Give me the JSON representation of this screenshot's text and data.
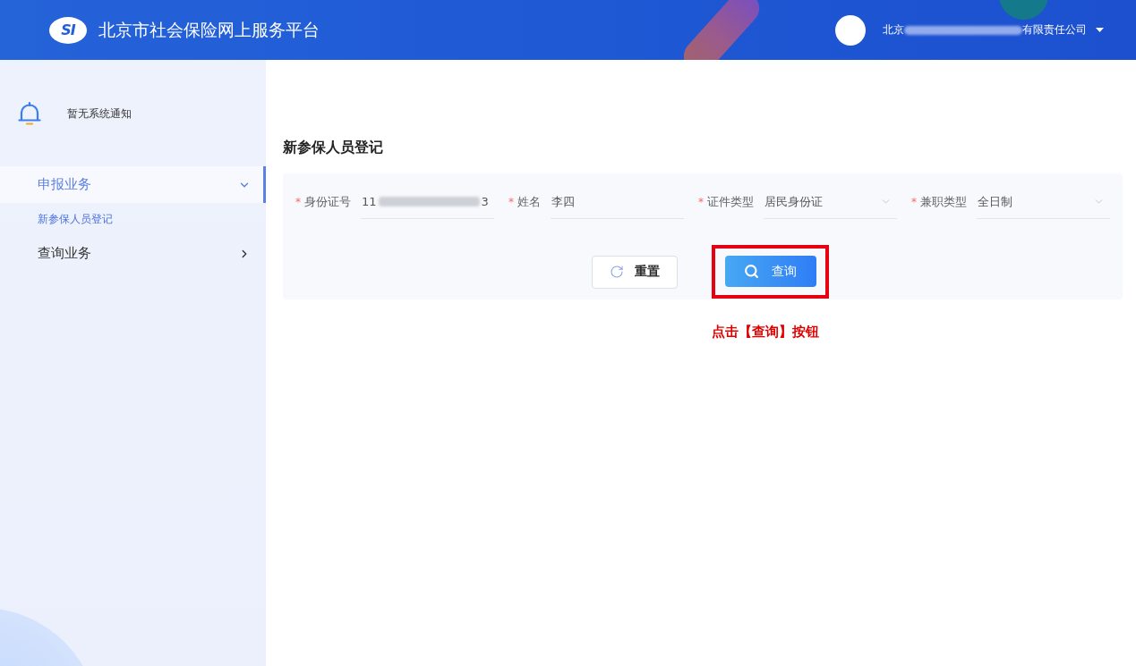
{
  "header": {
    "logo_text": "SI",
    "title": "北京市社会保险网上服务平台",
    "user": {
      "name_parts": [
        {
          "kind": "text",
          "text": "北京"
        },
        {
          "kind": "redacted"
        },
        {
          "kind": "text",
          "text": "有限责任公司"
        }
      ]
    }
  },
  "sidebar": {
    "notice": "暂无系统通知",
    "menu": [
      {
        "label": "申报业务",
        "selected": true,
        "expanded": true,
        "children": [
          {
            "label": "新参保人员登记",
            "selected": true
          }
        ]
      },
      {
        "label": "查询业务",
        "selected": false,
        "expanded": false
      }
    ]
  },
  "page": {
    "title": "新参保人员登记"
  },
  "form": {
    "fields": [
      {
        "kind": "input",
        "required_mark": "*",
        "label": "身份证号",
        "value_parts": [
          {
            "kind": "text",
            "text": "11"
          },
          {
            "kind": "redacted"
          },
          {
            "kind": "text",
            "text": "3"
          }
        ]
      },
      {
        "kind": "input",
        "required_mark": "*",
        "label": "姓名",
        "value_parts": [
          {
            "kind": "text",
            "text": "李四"
          }
        ]
      },
      {
        "kind": "select",
        "required_mark": "*",
        "label": "证件类型",
        "value_parts": [
          {
            "kind": "text",
            "text": "居民身份证"
          }
        ]
      },
      {
        "kind": "select",
        "required_mark": "*",
        "label": "兼职类型",
        "value_parts": [
          {
            "kind": "text",
            "text": "全日制"
          }
        ]
      }
    ],
    "buttons": [
      {
        "kind": "reset",
        "label": "重置",
        "highlighted": false
      },
      {
        "kind": "search",
        "label": "查询",
        "highlighted": true
      }
    ]
  },
  "annotation": {
    "text": "点击【查询】按钮"
  }
}
